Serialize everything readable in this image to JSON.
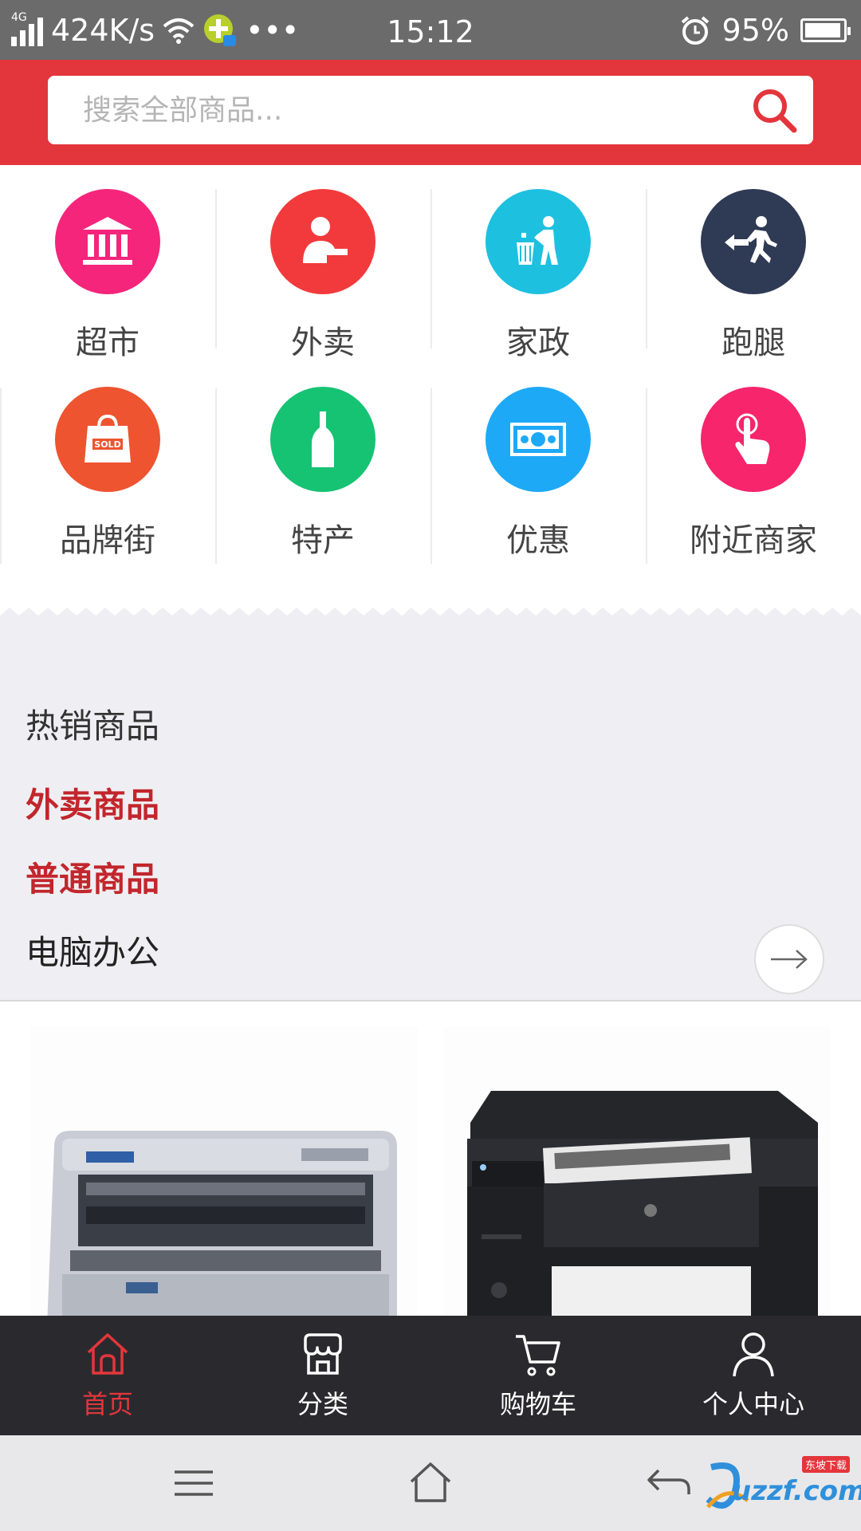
{
  "status": {
    "network_type": "4G",
    "speed": "424K/s",
    "more": "•••",
    "time": "15:12",
    "battery": "95%",
    "battery_level": 0.95
  },
  "search": {
    "placeholder": "搜索全部商品..."
  },
  "categories": [
    {
      "label": "超市",
      "icon": "bank-icon",
      "color": "#f5257b"
    },
    {
      "label": "外卖",
      "icon": "delivery-person-icon",
      "color": "#f23a3c"
    },
    {
      "label": "家政",
      "icon": "trash-can-person-icon",
      "color": "#1ec0e0"
    },
    {
      "label": "跑腿",
      "icon": "running-errand-icon",
      "color": "#2f3a54"
    },
    {
      "label": "品牌街",
      "icon": "shopping-bag-sold-icon",
      "color": "#ee5430"
    },
    {
      "label": "特产",
      "icon": "bottle-icon",
      "color": "#16c373"
    },
    {
      "label": "优惠",
      "icon": "money-bill-icon",
      "color": "#1ea9f7"
    },
    {
      "label": "附近商家",
      "icon": "tap-hand-icon",
      "color": "#f7256c"
    }
  ],
  "hot": {
    "title": "热销商品",
    "items": [
      "外卖商品",
      "普通商品",
      "电脑办公"
    ]
  },
  "tabs": [
    {
      "label": "首页",
      "icon": "home-icon"
    },
    {
      "label": "分类",
      "icon": "store-icon"
    },
    {
      "label": "购物车",
      "icon": "cart-icon"
    },
    {
      "label": "个人中心",
      "icon": "person-icon"
    }
  ],
  "watermark": {
    "text": "uzzf.com",
    "tag": "东坡下载"
  },
  "colors": {
    "brand": "#e3363c",
    "highlight": "#c2262c",
    "tabbar": "#2a2a2e"
  }
}
